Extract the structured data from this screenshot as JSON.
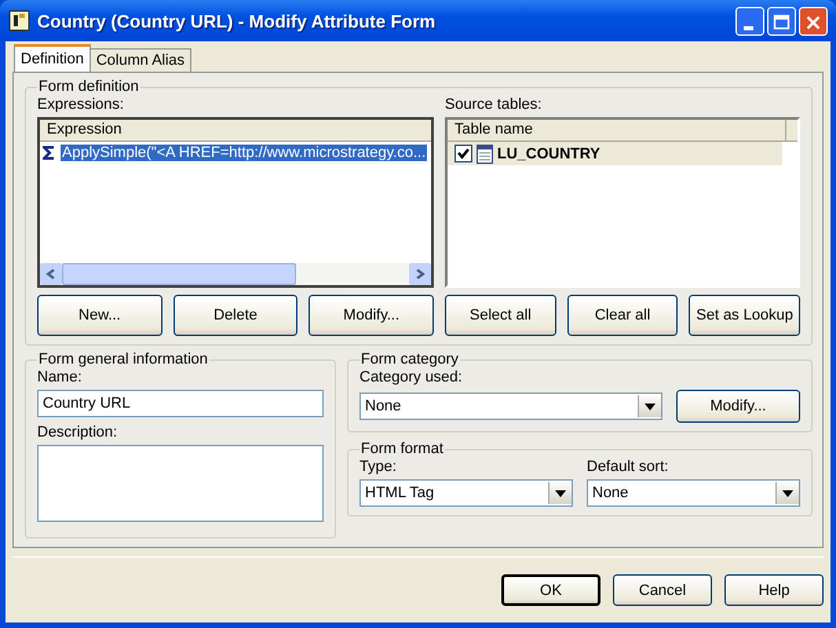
{
  "window": {
    "title": "Country (Country URL) - Modify Attribute Form"
  },
  "tabs": [
    {
      "label": "Definition",
      "selected": true
    },
    {
      "label": "Column Alias",
      "selected": false
    }
  ],
  "form_definition": {
    "title": "Form definition",
    "expressions": {
      "label": "Expressions:",
      "column": "Expression",
      "rows": [
        {
          "text": "ApplySimple(\"<A HREF=http://www.microstrategy.co...",
          "selected": true
        }
      ]
    },
    "source_tables": {
      "label": "Source tables:",
      "column": "Table name",
      "rows": [
        {
          "name": "LU_COUNTRY",
          "checked": true,
          "selected": true
        }
      ]
    },
    "expression_buttons": [
      "New...",
      "Delete",
      "Modify..."
    ],
    "table_buttons": [
      "Select all",
      "Clear all",
      "Set as Lookup"
    ]
  },
  "general_info": {
    "title": "Form general information",
    "name_label": "Name:",
    "name_value": "Country URL",
    "description_label": "Description:"
  },
  "form_category": {
    "title": "Form category",
    "label": "Category used:",
    "value": "None",
    "button": "Modify..."
  },
  "form_format": {
    "title": "Form format",
    "type_label": "Type:",
    "type_value": "HTML Tag",
    "sort_label": "Default sort:",
    "sort_value": "None"
  },
  "buttons": [
    {
      "label": "OK",
      "default": true
    },
    {
      "label": "Cancel",
      "default": false
    },
    {
      "label": "Help",
      "default": false
    }
  ]
}
